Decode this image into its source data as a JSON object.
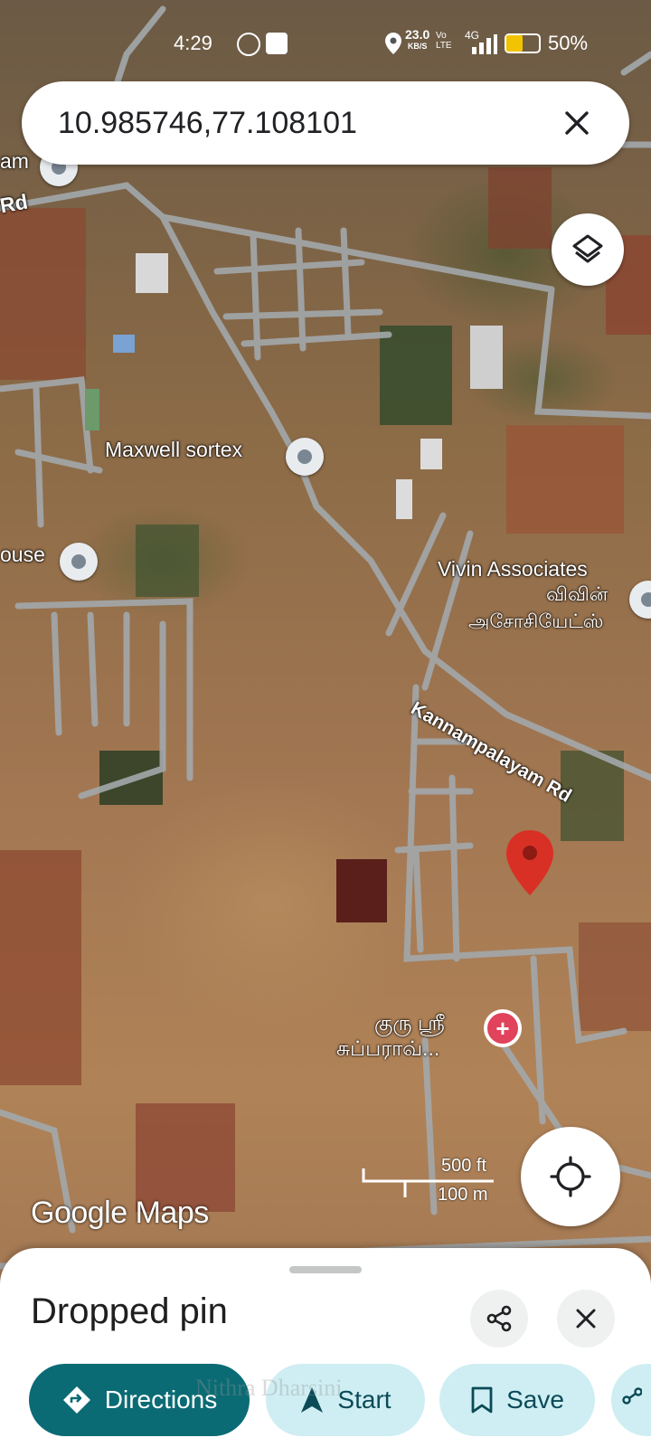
{
  "status_bar": {
    "time": "4:29",
    "data_speed": "23.0",
    "data_unit": "KB/S",
    "volte": "Vo LTE",
    "network": "4G",
    "battery": "50%"
  },
  "search": {
    "query": "10.985746,77.108101"
  },
  "map": {
    "places": [
      {
        "id": "topleft",
        "label": "am"
      },
      {
        "id": "maxwell",
        "label": "Maxwell sortex"
      },
      {
        "id": "house",
        "label": "ouse"
      },
      {
        "id": "vivin",
        "label": "Vivin Associates",
        "label2": "விவின்",
        "label3": "அசோசியேட்ஸ்"
      },
      {
        "id": "guru",
        "label": "குரு ஸ்ரீ",
        "label2": "சுப்பராவ்..."
      }
    ],
    "roads": [
      {
        "id": "rd-topleft",
        "label": "Rd"
      },
      {
        "id": "kannampalayam",
        "label": "Kannampalayam Rd"
      }
    ],
    "scale": {
      "imperial": "500 ft",
      "metric": "100 m"
    },
    "brand": "Google Maps",
    "watermark": "Nithra Dharsini",
    "pin_color": "#d93025"
  },
  "sheet": {
    "title": "Dropped pin",
    "actions": [
      {
        "id": "directions",
        "label": "Directions",
        "icon": "directions-icon"
      },
      {
        "id": "start",
        "label": "Start",
        "icon": "navigation-icon"
      },
      {
        "id": "save",
        "label": "Save",
        "icon": "bookmark-icon"
      }
    ]
  },
  "colors": {
    "primary": "#0b6b74",
    "chip_bg": "#cfeef3",
    "accent_text": "#0b4a57"
  }
}
